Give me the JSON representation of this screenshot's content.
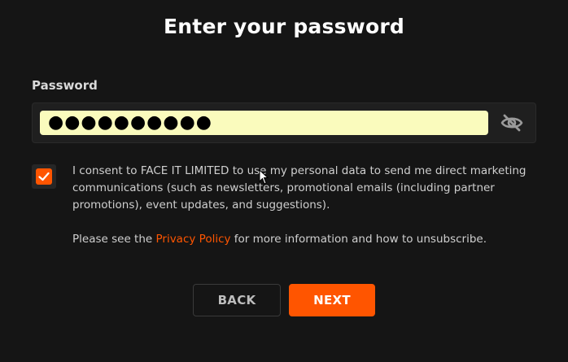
{
  "header": {
    "title": "Enter your password"
  },
  "password": {
    "label": "Password",
    "value": "●●●●●●●●●●",
    "visibility_icon": "eye-off-icon"
  },
  "consent": {
    "checked": true,
    "text": "I consent to FACE IT LIMITED to use my personal data to send me direct marketing communications (such as newsletters, promotional emails (including partner promotions), event updates, and suggestions)."
  },
  "privacy": {
    "prefix": "Please see the ",
    "link_text": "Privacy Policy",
    "suffix": " for more information and how to unsubscribe."
  },
  "actions": {
    "back_label": "BACK",
    "next_label": "NEXT"
  },
  "colors": {
    "accent": "#ff5500",
    "background": "#151515",
    "autofill": "#fafbbd"
  }
}
